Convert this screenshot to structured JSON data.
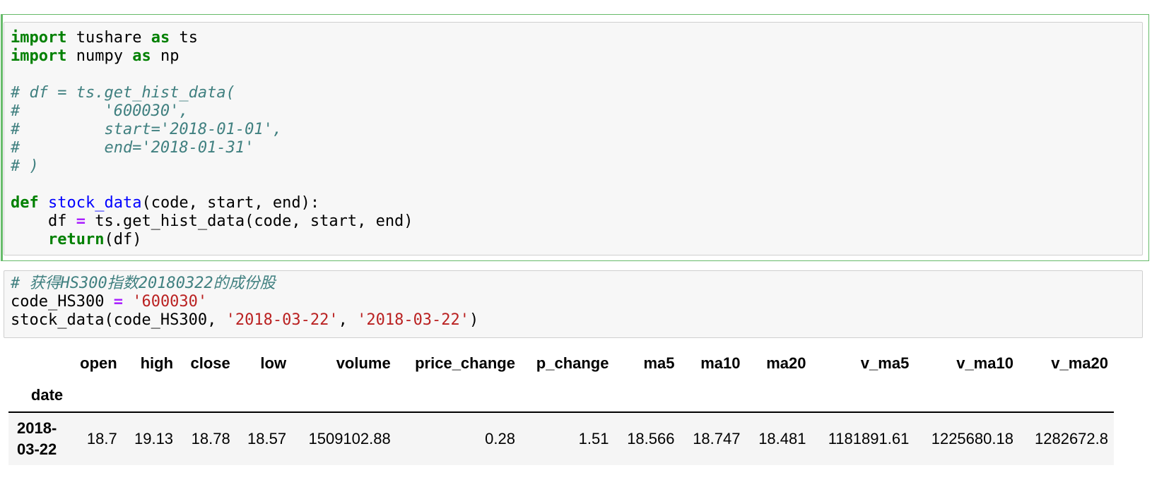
{
  "cell1": {
    "lines": [
      [
        {
          "t": "import",
          "c": "kw"
        },
        {
          "t": " tushare "
        },
        {
          "t": "as",
          "c": "kw"
        },
        {
          "t": " ts"
        }
      ],
      [
        {
          "t": "import",
          "c": "kw"
        },
        {
          "t": " numpy "
        },
        {
          "t": "as",
          "c": "kw"
        },
        {
          "t": " np"
        }
      ],
      [],
      [
        {
          "t": "# df = ts.get_hist_data(",
          "c": "cm"
        }
      ],
      [
        {
          "t": "#         '600030',",
          "c": "cm"
        }
      ],
      [
        {
          "t": "#         start='2018-01-01',",
          "c": "cm"
        }
      ],
      [
        {
          "t": "#         end='2018-01-31'",
          "c": "cm"
        }
      ],
      [
        {
          "t": "# )",
          "c": "cm"
        }
      ],
      [],
      [
        {
          "t": "def",
          "c": "kw"
        },
        {
          "t": " "
        },
        {
          "t": "stock_data",
          "c": "fn"
        },
        {
          "t": "(code, start, end):"
        }
      ],
      [
        {
          "t": "    df "
        },
        {
          "t": "=",
          "c": "op"
        },
        {
          "t": " ts.get_hist_data(code, start, end)"
        }
      ],
      [
        {
          "t": "    "
        },
        {
          "t": "return",
          "c": "kw"
        },
        {
          "t": "(df)"
        }
      ]
    ]
  },
  "cell2": {
    "lines": [
      [
        {
          "t": "# 获得HS300指数20180322的成份股",
          "c": "cm"
        }
      ],
      [
        {
          "t": "code_HS300 "
        },
        {
          "t": "=",
          "c": "op"
        },
        {
          "t": " "
        },
        {
          "t": "'600030'",
          "c": "st"
        }
      ],
      [
        {
          "t": "stock_data(code_HS300, "
        },
        {
          "t": "'2018-03-22'",
          "c": "st"
        },
        {
          "t": ", "
        },
        {
          "t": "'2018-03-22'",
          "c": "st"
        },
        {
          "t": ")"
        }
      ]
    ]
  },
  "output": {
    "columns": [
      "open",
      "high",
      "close",
      "low",
      "volume",
      "price_change",
      "p_change",
      "ma5",
      "ma10",
      "ma20",
      "v_ma5",
      "v_ma10",
      "v_ma20"
    ],
    "index_name": "date",
    "rows": [
      {
        "index": "2018-03-22",
        "values": [
          "18.7",
          "19.13",
          "18.78",
          "18.57",
          "1509102.88",
          "0.28",
          "1.51",
          "18.566",
          "18.747",
          "18.481",
          "1181891.61",
          "1225680.18",
          "1282672.8"
        ]
      }
    ]
  }
}
